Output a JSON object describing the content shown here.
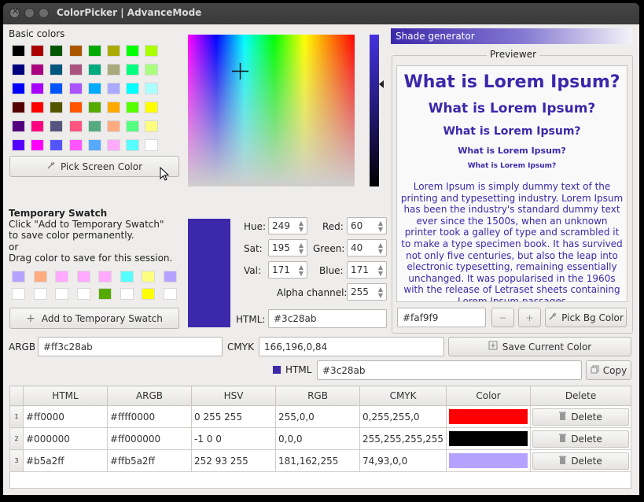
{
  "window": {
    "title": "ColorPicker | AdvanceMode"
  },
  "basic_colors": {
    "label": "Basic colors",
    "grid": [
      [
        "#000000",
        "#aa0000",
        "#005500",
        "#aa5500",
        "#00aa00",
        "#aaaa00",
        "#00ff00",
        "#aaff00"
      ],
      [
        "#00007f",
        "#aa007f",
        "#00557f",
        "#aa557f",
        "#00aa7f",
        "#aaaa7f",
        "#00ff7f",
        "#aaff7f"
      ],
      [
        "#0000ff",
        "#aa00ff",
        "#0055ff",
        "#aa55ff",
        "#00aaff",
        "#aaaaff",
        "#00ffff",
        "#aaffff"
      ],
      [
        "#550000",
        "#ff0000",
        "#555500",
        "#ff5500",
        "#55aa00",
        "#ffaa00",
        "#55ff00",
        "#ffff00"
      ],
      [
        "#55007f",
        "#ff007f",
        "#55557f",
        "#ff557f",
        "#55aa7f",
        "#ffaa7f",
        "#55ff7f",
        "#ffff7f"
      ],
      [
        "#5500ff",
        "#ff00ff",
        "#5555ff",
        "#ff55ff",
        "#55aaff",
        "#ffaaff",
        "#55ffff",
        "#ffffff"
      ]
    ]
  },
  "pick_screen_color": {
    "label": "Pick Screen Color"
  },
  "temporary_swatch": {
    "title": "Temporary Swatch",
    "line1": "Click \"Add to Temporary Swatch\"",
    "line2": "to save color permanently.",
    "line3": "or",
    "line4": "Drag color to save for this session.",
    "row1": [
      "#b5a2ff",
      "#ffaa7f",
      "#ffaaff",
      "#ffaaff",
      "#ffaaff",
      "#55ffff",
      "#ffff7f",
      "#b5a2ff"
    ],
    "row2": [
      "#ffffff",
      "#ffffff",
      "#ffffff",
      "#ffffff",
      "#55aa00",
      "#ffffff",
      "#ffff00",
      "#ffffff"
    ],
    "add_button": "Add to Temporary Swatch"
  },
  "current_color": "#3c28ab",
  "hsv": {
    "hue_label": "Hue:",
    "hue": "249",
    "sat_label": "Sat:",
    "sat": "195",
    "val_label": "Val:",
    "val": "171"
  },
  "rgb": {
    "red_label": "Red:",
    "red": "60",
    "green_label": "Green:",
    "green": "40",
    "blue_label": "Blue:",
    "blue": "171"
  },
  "alpha": {
    "label": "Alpha channel:",
    "value": "255"
  },
  "html_field": {
    "label": "HTML:",
    "value": "#3c28ab"
  },
  "shade_generator": {
    "label": "Shade generator"
  },
  "previewer": {
    "label": "Previewer",
    "h1": "What is Lorem Ipsum?",
    "h2": "What is Lorem Ipsum?",
    "h3": "What is Lorem Ipsum?",
    "h4": "What is Lorem Ipsum?",
    "h5": "What is Lorem Ipsum?",
    "body": "Lorem Ipsum is simply dummy text of the printing and typesetting industry. Lorem Ipsum has been the industry's standard dummy text ever since the 1500s, when an unknown printer took a galley of type and scrambled it to make a type specimen book. It has survived not only five centuries, but also the leap into electronic typesetting, remaining essentially unchanged. It was popularised in the 1960s with the release of Letraset sheets containing Lorem Ipsum passages"
  },
  "bg_field": {
    "value": "#faf9f9",
    "minus": "−",
    "plus": "+",
    "pick_bg": "Pick Bg Color"
  },
  "argb": {
    "label": "ARGB",
    "value": "#ff3c28ab"
  },
  "cmyk": {
    "label": "CMYK",
    "value": "166,196,0,84"
  },
  "save_current": "Save Current Color",
  "html_copy": {
    "label": "HTML",
    "value": "#3c28ab",
    "copy": "Copy"
  },
  "table": {
    "headers": [
      "HTML",
      "ARGB",
      "HSV",
      "RGB",
      "CMYK",
      "Color",
      "Delete"
    ],
    "rows": [
      {
        "num": "1",
        "html": "#ff0000",
        "argb": "#ffff0000",
        "hsv": "0 255 255",
        "rgb": "255,0,0",
        "cmyk": "0,255,255,0",
        "color": "#ff0000",
        "delete": "Delete"
      },
      {
        "num": "2",
        "html": "#000000",
        "argb": "#ff000000",
        "hsv": "-1 0 0",
        "rgb": "0,0,0",
        "cmyk": "255,255,255,255",
        "color": "#000000",
        "delete": "Delete"
      },
      {
        "num": "3",
        "html": "#b5a2ff",
        "argb": "#ffb5a2ff",
        "hsv": "252 93 255",
        "rgb": "181,162,255",
        "cmyk": "74,93,0,0",
        "color": "#b5a2ff",
        "delete": "Delete"
      }
    ]
  }
}
